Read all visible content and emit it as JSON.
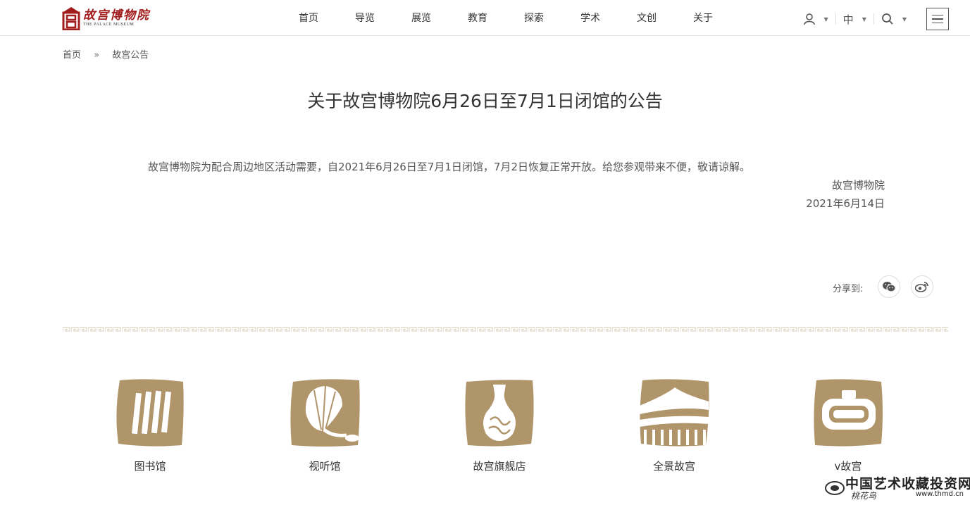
{
  "header": {
    "logo": {
      "cn": "故宫博物院",
      "en": "THE PALACE MUSEUM"
    },
    "nav": [
      "首页",
      "导览",
      "展览",
      "教育",
      "探索",
      "学术",
      "文创",
      "关于"
    ],
    "tools": {
      "user_icon": "user-icon",
      "language": "中",
      "search_icon": "search-icon",
      "menu_icon": "hamburger-icon"
    }
  },
  "breadcrumb": {
    "home": "首页",
    "separator": "»",
    "current": "故宫公告"
  },
  "article": {
    "title": "关于故宫博物院6月26日至7月1日闭馆的公告",
    "paragraph": "故宫博物院为配合周边地区活动需要，自2021年6月26日至7月1日闭馆，7月2日恢复正常开放。给您参观带来不便，敬请谅解。",
    "signature": "故宫博物院",
    "date": "2021年6月14日"
  },
  "share": {
    "label": "分享到:",
    "icons": [
      "wechat-icon",
      "weibo-icon"
    ]
  },
  "quick_links": [
    {
      "label": "图书馆",
      "icon": "library-books-icon"
    },
    {
      "label": "视听馆",
      "icon": "gramophone-icon"
    },
    {
      "label": "故宫旗舰店",
      "icon": "vase-icon"
    },
    {
      "label": "全景故宫",
      "icon": "palace-building-icon"
    },
    {
      "label": "v故宫",
      "icon": "vr-headset-icon"
    }
  ],
  "watermark": {
    "cn": "中国艺术收藏投资网",
    "url": "www.thmd.cn",
    "sub": "桃花鸟"
  },
  "colors": {
    "brand_red": "#a11c1c",
    "icon_tan": "#b0946a"
  }
}
